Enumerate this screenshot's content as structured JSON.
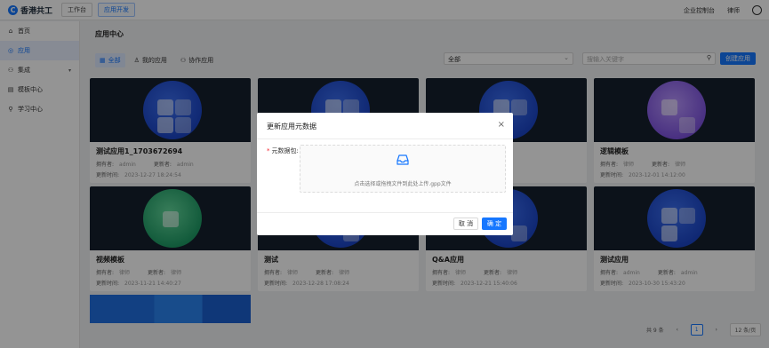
{
  "app": {
    "logo_mark": "C",
    "logo_text": "香港共工"
  },
  "topnav": [
    {
      "label": "工作台"
    },
    {
      "label": "应用开发"
    }
  ],
  "topright": {
    "console": "企业控制台",
    "user_name": "律师"
  },
  "sidebar": {
    "items": [
      {
        "label": "首页",
        "icon": "home-icon",
        "glyph": "⌂"
      },
      {
        "label": "应用",
        "icon": "app-icon",
        "glyph": "◎"
      },
      {
        "label": "集成",
        "icon": "integration-icon",
        "glyph": "⚇"
      },
      {
        "label": "模板中心",
        "icon": "template-icon",
        "glyph": "▤"
      },
      {
        "label": "学习中心",
        "icon": "learning-icon",
        "glyph": "⚲"
      }
    ]
  },
  "main": {
    "title": "应用中心",
    "filters": [
      {
        "label": "全部",
        "glyph": "▦"
      },
      {
        "label": "我的应用",
        "glyph": "♙"
      },
      {
        "label": "协作应用",
        "glyph": "⚇"
      }
    ],
    "select_value": "全部",
    "search_placeholder": "搜输入关键字",
    "create_label": "创建应用"
  },
  "cards": [
    {
      "title": "测试应用1_1703672694",
      "owner_label": "拥有者:",
      "owner": "admin",
      "updater_label": "更新者:",
      "updater": "admin",
      "time_label": "更新时间:",
      "time": "2023-12-27 18:24:54"
    },
    {
      "title": "",
      "owner_label": "",
      "owner": "",
      "updater_label": "",
      "updater": "",
      "time_label": "",
      "time": ""
    },
    {
      "title": "",
      "owner_label": "",
      "owner": "",
      "updater_label": "",
      "updater": "",
      "time_label": "",
      "time": ""
    },
    {
      "title": "逻辑模板",
      "owner_label": "拥有者:",
      "owner": "律师",
      "updater_label": "更新者:",
      "updater": "律师",
      "time_label": "更新时间:",
      "time": "2023-12-01 14:12:00"
    },
    {
      "title": "视频模板",
      "owner_label": "拥有者:",
      "owner": "律师",
      "updater_label": "更新者:",
      "updater": "律师",
      "time_label": "更新时间:",
      "time": "2023-11-21 14:40:27"
    },
    {
      "title": "测试",
      "owner_label": "拥有者:",
      "owner": "律师",
      "updater_label": "更新者:",
      "updater": "律师",
      "time_label": "更新时间:",
      "time": "2023-12-28 17:08:24"
    },
    {
      "title": "Q&A应用",
      "owner_label": "拥有者:",
      "owner": "律师",
      "updater_label": "更新者:",
      "updater": "律师",
      "time_label": "更新时间:",
      "time": "2023-12-21 15:40:06"
    },
    {
      "title": "测试应用",
      "owner_label": "拥有者:",
      "owner": "admin",
      "updater_label": "更新者:",
      "updater": "admin",
      "time_label": "更新时间:",
      "time": "2023-10-30 15:43:20"
    }
  ],
  "pager": {
    "total": "共 9 条",
    "prev": "‹",
    "current": "1",
    "next": "›",
    "size": "12 条/页"
  },
  "modal": {
    "title": "更新应用元数据",
    "close": "×",
    "field_required": "*",
    "field_label": "元数据包:",
    "upload_hint": "点击选择或拖拽文件到此处上传.gpp文件",
    "cancel": "取 消",
    "confirm": "确 定"
  },
  "colors": {
    "accent": "#1677ff",
    "overlay": "rgba(0,0,0,0.42)"
  }
}
